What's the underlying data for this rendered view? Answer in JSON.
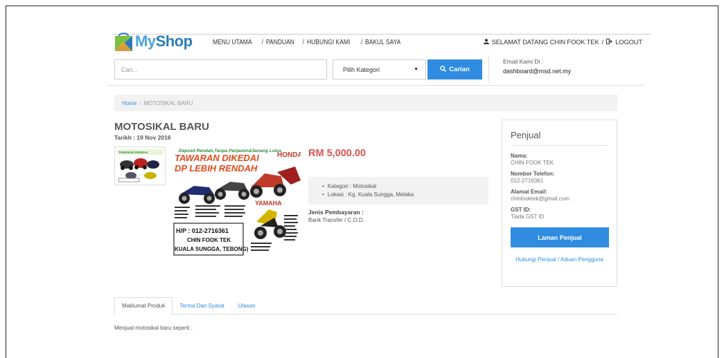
{
  "brand": {
    "my": "My",
    "shop": "Shop"
  },
  "nav": {
    "items": [
      "MENU UTAMA",
      "PANDUAN",
      "HUBUNGI KAMI",
      "BAKUL SAYA"
    ],
    "sep": "/"
  },
  "user": {
    "greeting": "SELAMAT DATANG CHIN FOOK TEK",
    "sep": "/",
    "logout": "LOGOUT"
  },
  "search": {
    "placeholder": "Cari...",
    "category": "Pilih Kategori",
    "button": "Carian"
  },
  "contact": {
    "label": "Email Kami Di :",
    "email": "dashboard@msd.net.my"
  },
  "breadcrumb": {
    "home": "Home",
    "sep": "/",
    "current": "MOTOSIKAL BARU"
  },
  "product": {
    "title": "MOTOSIKAL BARU",
    "date": "Tarikh : 19 Nov 2016",
    "price": "RM 5,000.00",
    "details": [
      "Kategori : Motosikal",
      "Lokasi : Kg. Kuala Sungga, Melaka"
    ],
    "payment_label": "Jenis Pembayaran :",
    "payment_value": "Bank Transfer / C.O.D.",
    "image_text": {
      "headline1": "Deposit Rendah,Tanpa Penjamin&Senang Lulus",
      "headline2": "TAWARAN DIKEDAI",
      "headline3": "DP LEBIH RENDAH",
      "brand1": "HONDA",
      "brand2": "YAMAHA",
      "hp": "H/P : 012-2716361",
      "name": "CHIN FOOK TEK",
      "loc": "KUALA SUNGGA, TEBONG)"
    }
  },
  "seller": {
    "heading": "Penjual",
    "name_label": "Nama:",
    "name": "CHIN FOOK TEK",
    "phone_label": "Nombor Telefon:",
    "phone": "012-2716361",
    "email_label": "Alamat Email:",
    "email": "chinfooktek@gmail.com",
    "gst_label": "GST ID:",
    "gst": "Tiada GST ID",
    "laman_button": "Laman Penjual",
    "hubungi_link": "Hubungi Penjual / Aduan Pengguna"
  },
  "tabs": [
    "Maklumat Produk",
    "Terma Dan Syarat",
    "Ulasan"
  ],
  "description": "Menjual motosikal baru seperti :",
  "colors": {
    "accent": "#2f8ce0",
    "price": "#d9534f",
    "logo_green": "#7bc143",
    "logo_blue": "#4aa3df"
  }
}
